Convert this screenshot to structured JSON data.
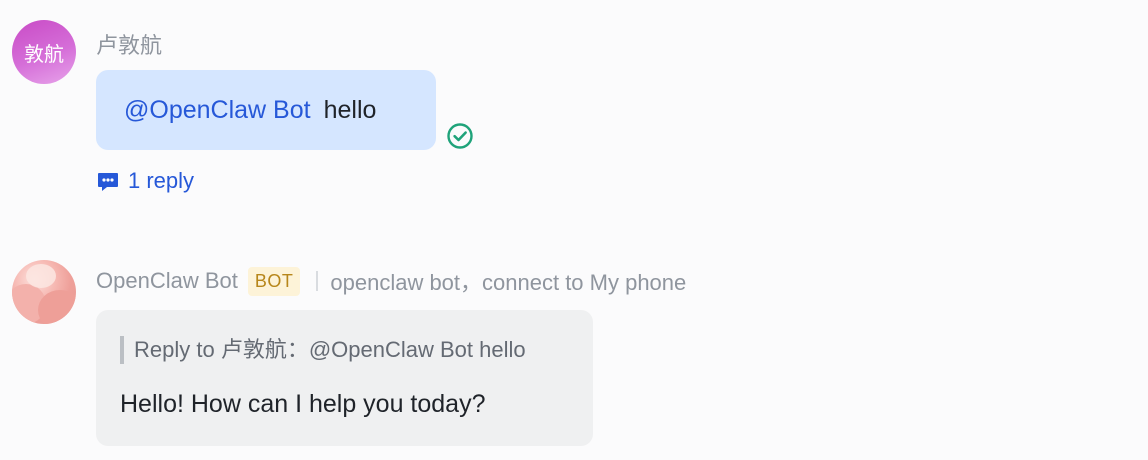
{
  "messages": [
    {
      "sender": "卢敦航",
      "avatar_text": "敦航",
      "mention": "@OpenClaw Bot",
      "text": "hello",
      "reply_count_label": "1 reply",
      "status": "read"
    },
    {
      "sender": "OpenClaw Bot",
      "badge": "BOT",
      "description": "openclaw bot，connect to My phone",
      "quote": "Reply to 卢敦航：@OpenClaw Bot hello",
      "text": "Hello! How can I help you today?"
    }
  ],
  "colors": {
    "mention": "#2658d8",
    "user_bubble": "#d5e6ff",
    "bot_bubble": "#eff0f1",
    "read_check": "#1fa37a",
    "badge_bg": "#fdf3d8",
    "badge_text": "#b7861a"
  },
  "icons": {
    "read_status": "check-circle-icon",
    "thread": "chat-bubble-icon"
  }
}
